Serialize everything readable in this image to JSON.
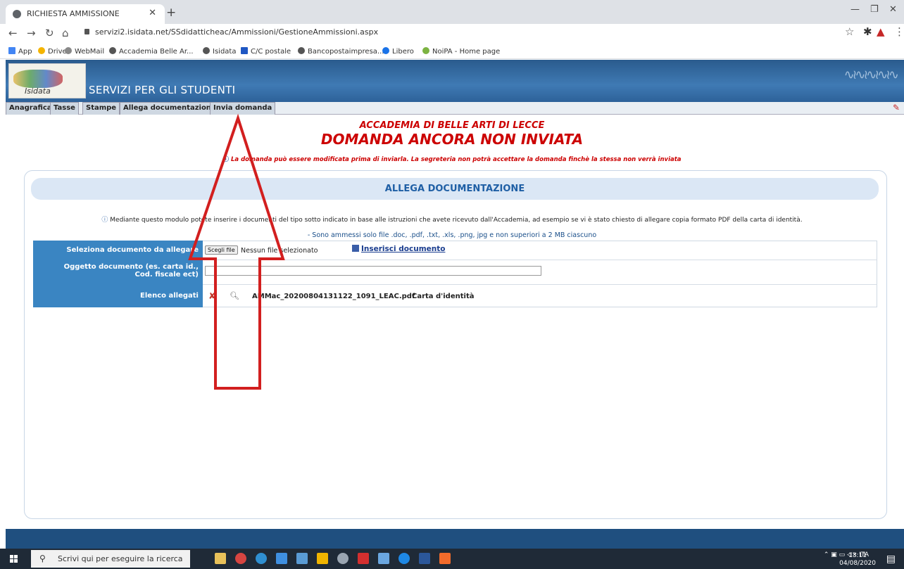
{
  "browser": {
    "tab_title": "RICHIESTA AMMISSIONE",
    "url": "servizi2.isidata.net/SSdidatticheac/Ammissioni/GestioneAmmissioni.aspx",
    "bookmarks": [
      "App",
      "Drive",
      "WebMail",
      "Accademia Belle Ar...",
      "Isidata",
      "C/C postale",
      "Bancopostaimpresa...",
      "Libero",
      "NoiPA - Home page"
    ]
  },
  "site": {
    "logo_text": "Isidata",
    "service_title": "SERVIZI PER GLI STUDENTI"
  },
  "nav_tabs": [
    "Anagrafica",
    "Tasse",
    "Stampe",
    "Allega documentazione",
    "Invia domanda"
  ],
  "main": {
    "institution": "ACCADEMIA DI BELLE ARTI DI LECCE",
    "status": "DOMANDA ANCORA NON INVIATA",
    "warning": "La domanda può essere modificata prima di inviarla. La segreteria non potrà accettare la domanda finchè la stessa non verrà inviata",
    "section_title": "ALLEGA DOCUMENTAZIONE",
    "info_text": "Mediante questo modulo potete inserire i documenti del tipo sotto indicato in base alle istruzioni che avete ricevuto dall'Accademia, ad esempio se vi è stato chiesto di allegare copia formato PDF della carta di identità.",
    "allowed_text": "- Sono ammessi solo file .doc, .pdf, .txt, .xls, .png, jpg e non superiori a 2 MB ciascuno"
  },
  "form": {
    "select_label": "Seleziona documento da allegare",
    "choose_file_label": "Scegli file",
    "no_file_text": "Nessun file selezionato",
    "insert_label": "Inserisci documento",
    "subject_label": "Oggetto documento (es. carta id., Cod. fiscale ect)",
    "subject_value": "",
    "attachments_label": "Elenco allegati",
    "attachments": [
      {
        "filename": "AMMac_20200804131122_1091_LEAC.pdf",
        "type": "Carta d'identità"
      }
    ]
  },
  "taskbar": {
    "search_placeholder": "Scrivi qui per eseguire la ricerca",
    "language": "ITA",
    "time": "13:11",
    "date": "04/08/2020"
  },
  "colors": {
    "header_blue": "#3f7ab4",
    "label_blue": "#3a85c2",
    "alert_red": "#cc0000",
    "annotation_red": "#d21f1f"
  }
}
